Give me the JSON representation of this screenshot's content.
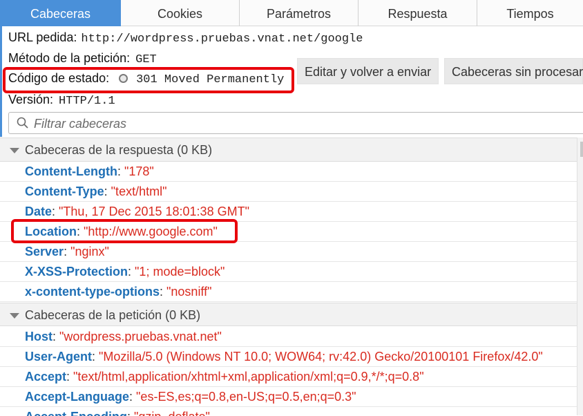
{
  "tabs": [
    {
      "label": "Cabeceras",
      "active": true
    },
    {
      "label": "Cookies",
      "active": false
    },
    {
      "label": "Parámetros",
      "active": false
    },
    {
      "label": "Respuesta",
      "active": false
    },
    {
      "label": "Tiempos",
      "active": false
    }
  ],
  "summary": {
    "url_label": "URL pedida:",
    "url_value": "http://wordpress.pruebas.vnat.net/google",
    "method_label": "Método de la petición:",
    "method_value": "GET",
    "status_label": "Código de estado:",
    "status_value": "301 Moved Permanently",
    "version_label": "Versión:",
    "version_value": "HTTP/1.1"
  },
  "actions": {
    "edit_resend": "Editar y volver a enviar",
    "raw_headers": "Cabeceras sin procesar"
  },
  "filter": {
    "placeholder": "Filtrar cabeceras"
  },
  "response_section": {
    "title": "Cabeceras de la respuesta (0 KB)",
    "headers": [
      {
        "name": "Content-Length",
        "value": "\"178\""
      },
      {
        "name": "Content-Type",
        "value": "\"text/html\""
      },
      {
        "name": "Date",
        "value": "\"Thu, 17 Dec 2015 18:01:38 GMT\""
      },
      {
        "name": "Location",
        "value": "\"http://www.google.com\""
      },
      {
        "name": "Server",
        "value": "\"nginx\""
      },
      {
        "name": "X-XSS-Protection",
        "value": "\"1; mode=block\""
      },
      {
        "name": "x-content-type-options",
        "value": "\"nosniff\""
      }
    ]
  },
  "request_section": {
    "title": "Cabeceras de la petición (0 KB)",
    "headers": [
      {
        "name": "Host",
        "value": "\"wordpress.pruebas.vnat.net\""
      },
      {
        "name": "User-Agent",
        "value": "\"Mozilla/5.0 (Windows NT 10.0; WOW64; rv:42.0) Gecko/20100101 Firefox/42.0\""
      },
      {
        "name": "Accept",
        "value": "\"text/html,application/xhtml+xml,application/xml;q=0.9,*/*;q=0.8\""
      },
      {
        "name": "Accept-Language",
        "value": "\"es-ES,es;q=0.8,en-US;q=0.5,en;q=0.3\""
      },
      {
        "name": "Accept-Encoding",
        "value": "\"gzip, deflate\""
      }
    ]
  },
  "colors": {
    "accent": "#4a90d9",
    "highlight_box": "#e8000b",
    "header_name": "#1f6fb5",
    "header_value": "#d92b20"
  },
  "icons": {
    "filter": "search-icon",
    "section_toggle": "triangle-down-icon",
    "status": "status-circle-icon"
  }
}
